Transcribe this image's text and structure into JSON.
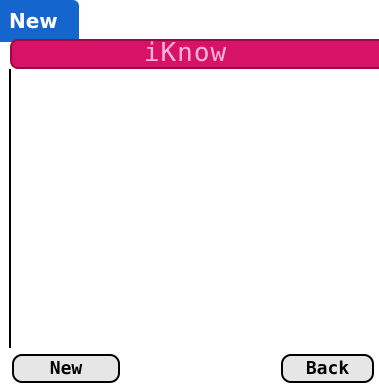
{
  "title": {
    "label": "New"
  },
  "banner": {
    "text": "iKnow"
  },
  "buttons": {
    "new_label": "New",
    "back_label": "Back"
  },
  "colors": {
    "title_bar": "#1565cf",
    "banner_fill": "#d61366",
    "banner_text": "#ffb3d6",
    "button_fill": "#e6e6e6"
  }
}
